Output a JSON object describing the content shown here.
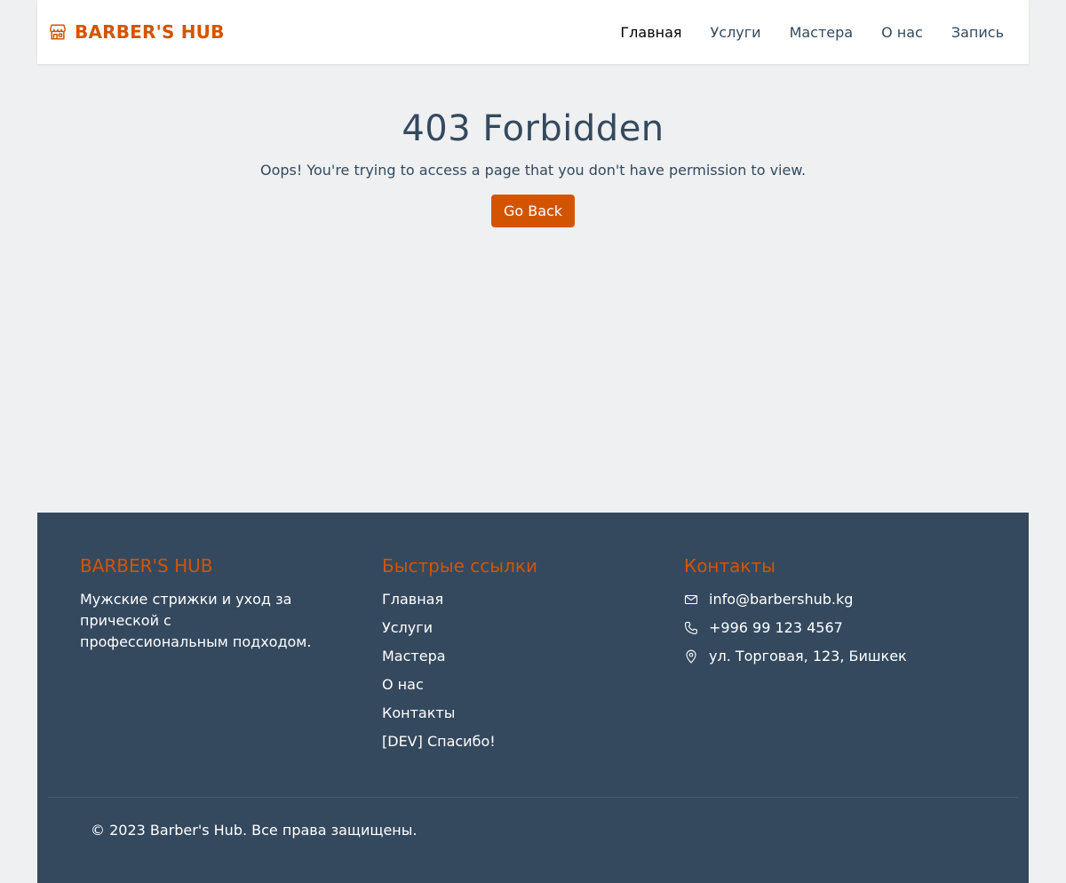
{
  "header": {
    "brand": "BARBER'S HUB",
    "brand_icon": "shop-icon",
    "nav": [
      {
        "label": "Главная",
        "active": true
      },
      {
        "label": "Услуги",
        "active": false
      },
      {
        "label": "Мастера",
        "active": false
      },
      {
        "label": "О нас",
        "active": false
      },
      {
        "label": "Запись",
        "active": false
      }
    ]
  },
  "main": {
    "title": "403 Forbidden",
    "message": "Oops! You're trying to access a page that you don't have permission to view.",
    "back_button": "Go Back"
  },
  "footer": {
    "about": {
      "title": "BARBER'S HUB",
      "text": "Мужские стрижки и уход за прической с профессиональным подходом."
    },
    "quick_links": {
      "title": "Быстрые ссылки",
      "items": [
        "Главная",
        "Услуги",
        "Мастера",
        "О нас",
        "Контакты",
        "[DEV] Спасибо!"
      ]
    },
    "contacts": {
      "title": "Контакты",
      "email": "info@barbershub.kg",
      "phone": "+996 99 123 4567",
      "address": "ул. Торговая, 123, Бишкек",
      "icons": [
        "envelope-icon",
        "phone-icon",
        "map-pin-icon"
      ]
    },
    "copyright": "© 2023 Barber's Hub. Все права защищены."
  },
  "colors": {
    "accent": "#d35400",
    "text": "#34495e",
    "footer_bg": "#34495e",
    "page_bg": "#eef0f1"
  }
}
